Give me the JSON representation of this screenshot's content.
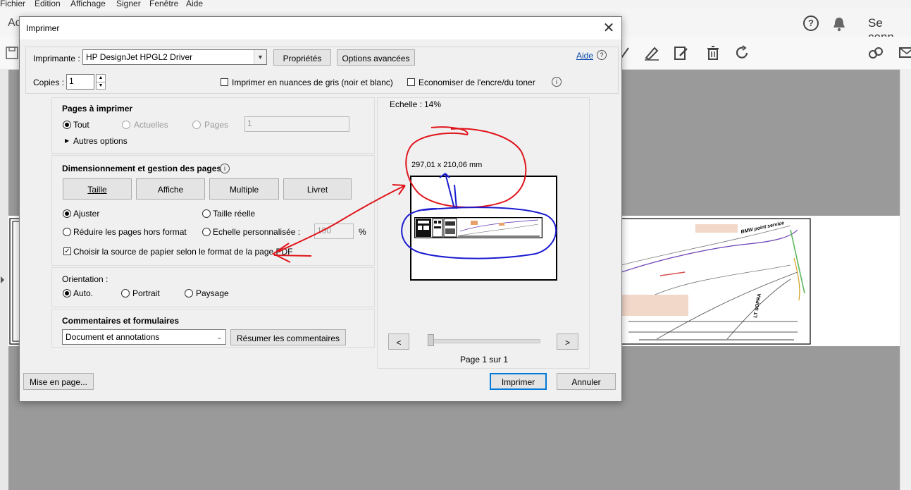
{
  "app": {
    "menu": [
      "Fichier",
      "Edition",
      "Affichage",
      "Signer",
      "Fenêtre",
      "Aide"
    ],
    "toolbar_left_partial": "Ac",
    "signin_label": "Se conn"
  },
  "dialog": {
    "title": "Imprimer",
    "printer_label": "Imprimante :",
    "printer_value": "HP DesignJet HPGL2 Driver",
    "properties_button": "Propriétés",
    "advanced_button": "Options avancées",
    "help_link": "Aide",
    "copies_label": "Copies :",
    "copies_value": "1",
    "grayscale_label": "Imprimer en nuances de gris (noir et blanc)",
    "save_ink_label": "Economiser de l'encre/du toner",
    "pages_section": {
      "title": "Pages à imprimer",
      "all_label": "Tout",
      "current_label": "Actuelles",
      "pages_label": "Pages",
      "pages_value": "1",
      "more_options": "Autres options"
    },
    "sizing_section": {
      "title": "Dimensionnement et gestion des pages",
      "buttons": [
        "Taille",
        "Affiche",
        "Multiple",
        "Livret"
      ],
      "fit_label": "Ajuster",
      "actual_size_label": "Taille réelle",
      "shrink_label": "Réduire les pages hors format",
      "custom_scale_label": "Echelle personnalisée :",
      "custom_scale_value": "100",
      "percent": "%",
      "paper_source_label": "Choisir la source de papier selon le format de la page PDF"
    },
    "orientation_section": {
      "title": "Orientation :",
      "auto_label": "Auto.",
      "portrait_label": "Portrait",
      "landscape_label": "Paysage"
    },
    "comments_section": {
      "title": "Commentaires et formulaires",
      "select_value": "Document et annotations",
      "summarize_button": "Résumer les commentaires"
    },
    "preview": {
      "scale_label": "Echelle :",
      "scale_value": "14%",
      "dimensions": "297,01 x 210,06 mm",
      "prev_button": "<",
      "next_button": ">",
      "page_indicator": "Page 1 sur 1"
    },
    "page_setup_button": "Mise en page...",
    "print_button": "Imprimer",
    "cancel_button": "Annuler"
  },
  "background_drawing_labels": [
    "BMW point service",
    "LT SOPRA"
  ],
  "annotation_colors": {
    "red": "#e0141b",
    "blue": "#1a1ad0"
  }
}
